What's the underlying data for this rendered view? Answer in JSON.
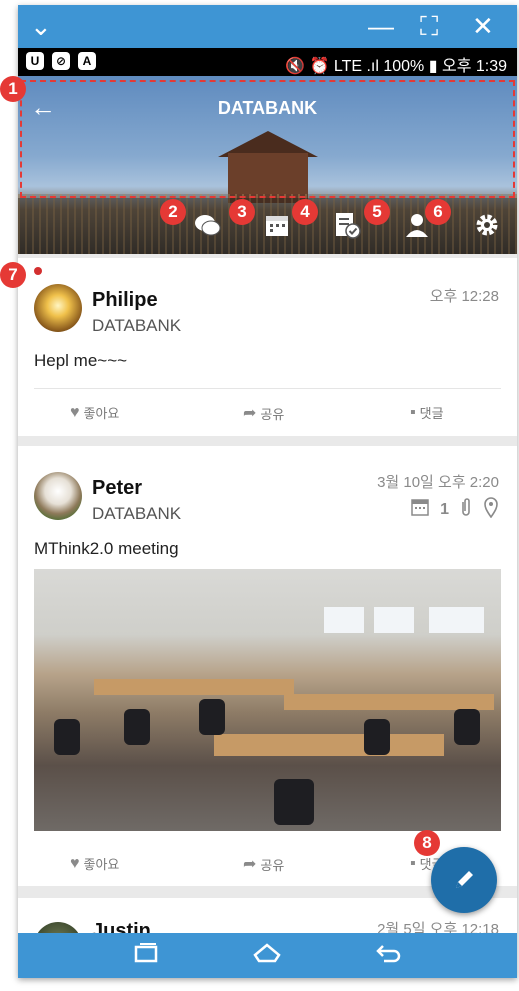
{
  "window": {
    "minimize_icon": "—",
    "fullscreen_icon": "⛶",
    "close_icon": "✕",
    "collapse_icon": "⌄"
  },
  "statusbar": {
    "left_icons": [
      "U",
      "⊘",
      "A"
    ],
    "right_text": "🔇 ⏰ LTE .ıl 100% ▮ 오후 1:39"
  },
  "header": {
    "back_icon": "←",
    "title": "DATABANK"
  },
  "header_icons": [
    "chat-icon",
    "calendar-icon",
    "task-check-icon",
    "person-icon",
    "gear-icon"
  ],
  "badges": [
    "1",
    "2",
    "3",
    "4",
    "5",
    "6",
    "7",
    "8"
  ],
  "posts": [
    {
      "author": "Philipe",
      "team": "DATABANK",
      "time": "오후 12:28",
      "text": "Hepl me~~~",
      "actions": {
        "like": "좋아요",
        "share": "공유",
        "comment": "댓글"
      }
    },
    {
      "author": "Peter",
      "team": "DATABANK",
      "time": "3월 10일 오후 2:20",
      "attachment_count": "1",
      "text": "MThink2.0 meeting",
      "actions": {
        "like": "좋아요",
        "share": "공유",
        "comment": "댓글"
      }
    },
    {
      "author": "Justin",
      "time": "2월 5일 오후 12:18"
    }
  ],
  "colors": {
    "accent": "#3e95d4",
    "badge": "#e53935",
    "fab": "#1f6ea9"
  }
}
